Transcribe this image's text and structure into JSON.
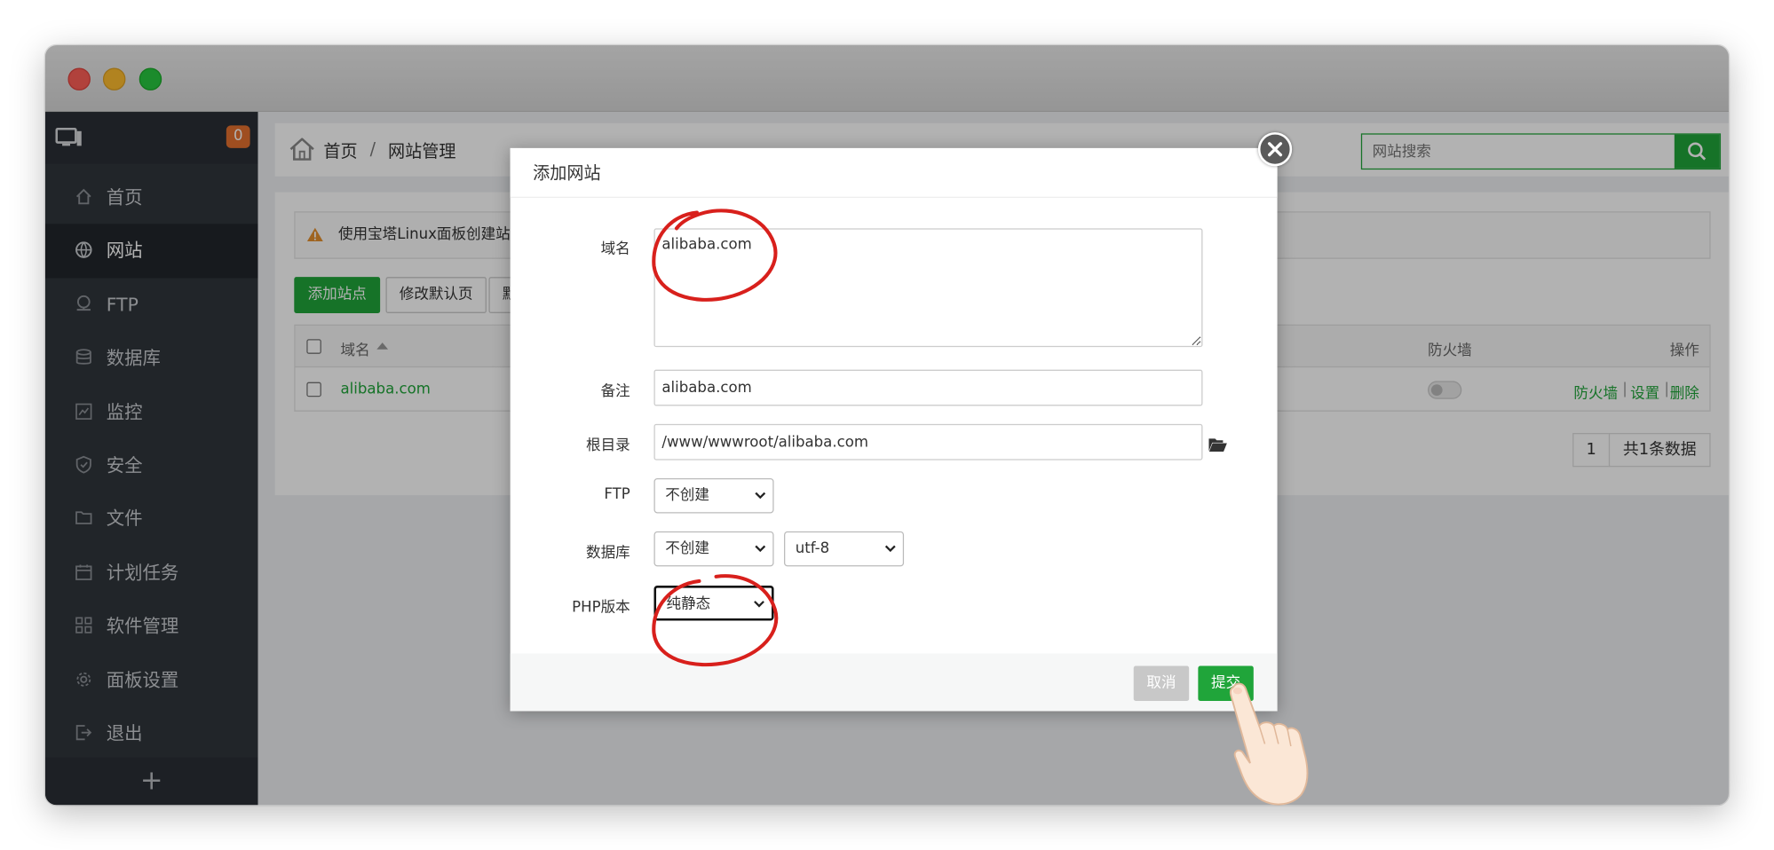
{
  "sidebar": {
    "badge": "0",
    "items": [
      {
        "label": "首页",
        "icon": "home-icon"
      },
      {
        "label": "网站",
        "icon": "globe-icon",
        "active": true
      },
      {
        "label": "FTP",
        "icon": "ftp-icon"
      },
      {
        "label": "数据库",
        "icon": "database-icon"
      },
      {
        "label": "监控",
        "icon": "monitor-chart-icon"
      },
      {
        "label": "安全",
        "icon": "shield-icon"
      },
      {
        "label": "文件",
        "icon": "folder-icon"
      },
      {
        "label": "计划任务",
        "icon": "calendar-icon"
      },
      {
        "label": "软件管理",
        "icon": "grid-icon"
      },
      {
        "label": "面板设置",
        "icon": "gear-icon"
      },
      {
        "label": "退出",
        "icon": "logout-icon"
      }
    ],
    "add_label": "+"
  },
  "header": {
    "crumb_home": "首页",
    "crumb_sep": "/",
    "crumb_current": "网站管理",
    "search_placeholder": "网站搜索"
  },
  "content": {
    "alert": "使用宝塔Linux面板创建站点",
    "buttons": {
      "add_site": "添加站点",
      "modify_default": "修改默认页",
      "third": "默"
    },
    "table": {
      "col_domain": "域名",
      "col_firewall": "防火墙",
      "col_ops": "操作",
      "row": {
        "domain": "alibaba.com",
        "op_firewall": "防火墙",
        "op_settings": "设置",
        "op_delete": "删除",
        "sep": "|"
      }
    },
    "pager": {
      "page": "1",
      "total": "共1条数据"
    }
  },
  "modal": {
    "title": "添加网站",
    "domain_label": "域名",
    "domain_value": "alibaba.com",
    "note_label": "备注",
    "note_value": "alibaba.com",
    "root_label": "根目录",
    "root_value": "/www/wwwroot/alibaba.com",
    "ftp_label": "FTP",
    "ftp_value": "不创建",
    "db_label": "数据库",
    "db_value": "不创建",
    "charset_value": "utf-8",
    "php_label": "PHP版本",
    "php_value": "纯静态",
    "cancel": "取消",
    "submit": "提交"
  },
  "colors": {
    "accent": "#20a53a",
    "sidebar": "#30353c",
    "badge": "#e4702f",
    "annotation": "#d8201c"
  }
}
